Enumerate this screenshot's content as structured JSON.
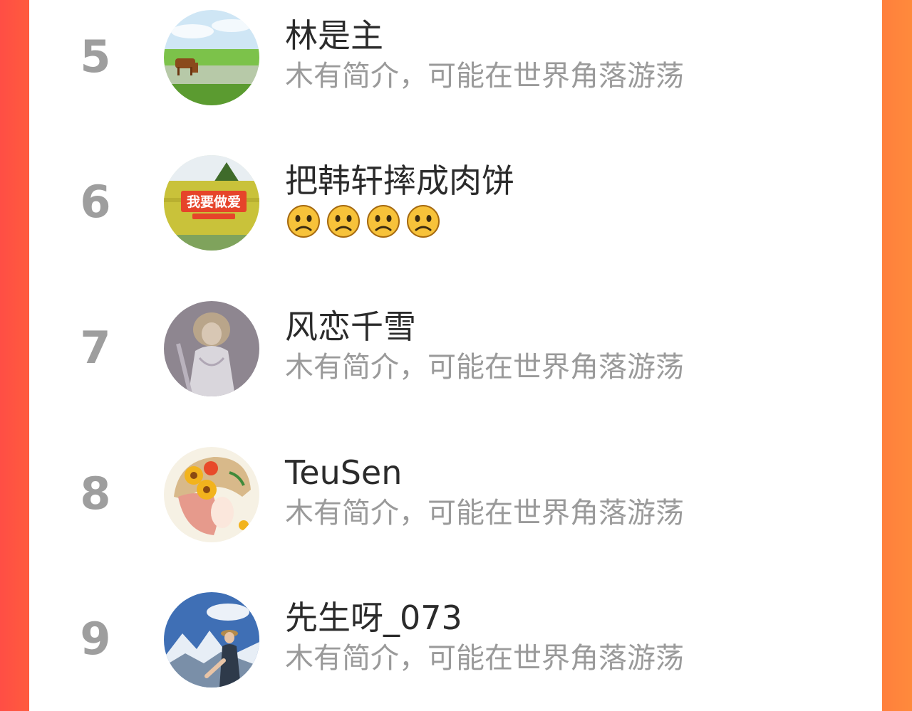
{
  "ranking_list": [
    {
      "rank": "5",
      "name": "林是主",
      "bio": "木有简介，可能在世界角落游荡",
      "avatar": "cow-grassland-avatar"
    },
    {
      "rank": "6",
      "name": "把韩轩摔成肉饼",
      "bio_emojis": [
        "confused-face-emoji",
        "confused-face-emoji",
        "confused-face-emoji",
        "confused-face-emoji"
      ],
      "avatar": "billboard-avatar",
      "avatar_sign_text": "我要做爱"
    },
    {
      "rank": "7",
      "name": "风恋千雪",
      "bio": "木有简介，可能在世界角落游荡",
      "avatar": "figurine-avatar"
    },
    {
      "rank": "8",
      "name": "TeuSen",
      "bio": "木有简介，可能在世界角落游荡",
      "avatar": "sunflower-girl-avatar"
    },
    {
      "rank": "9",
      "name": "先生呀_073",
      "bio": "木有简介，可能在世界角落游荡",
      "avatar": "mountain-hiker-avatar"
    }
  ],
  "colors": {
    "background_gradient_left": "#ff4e45",
    "background_gradient_right": "#ff8a3c",
    "rank_color": "#9e9e9e",
    "name_color": "#2b2b2b",
    "bio_color": "#9a9a9a"
  }
}
